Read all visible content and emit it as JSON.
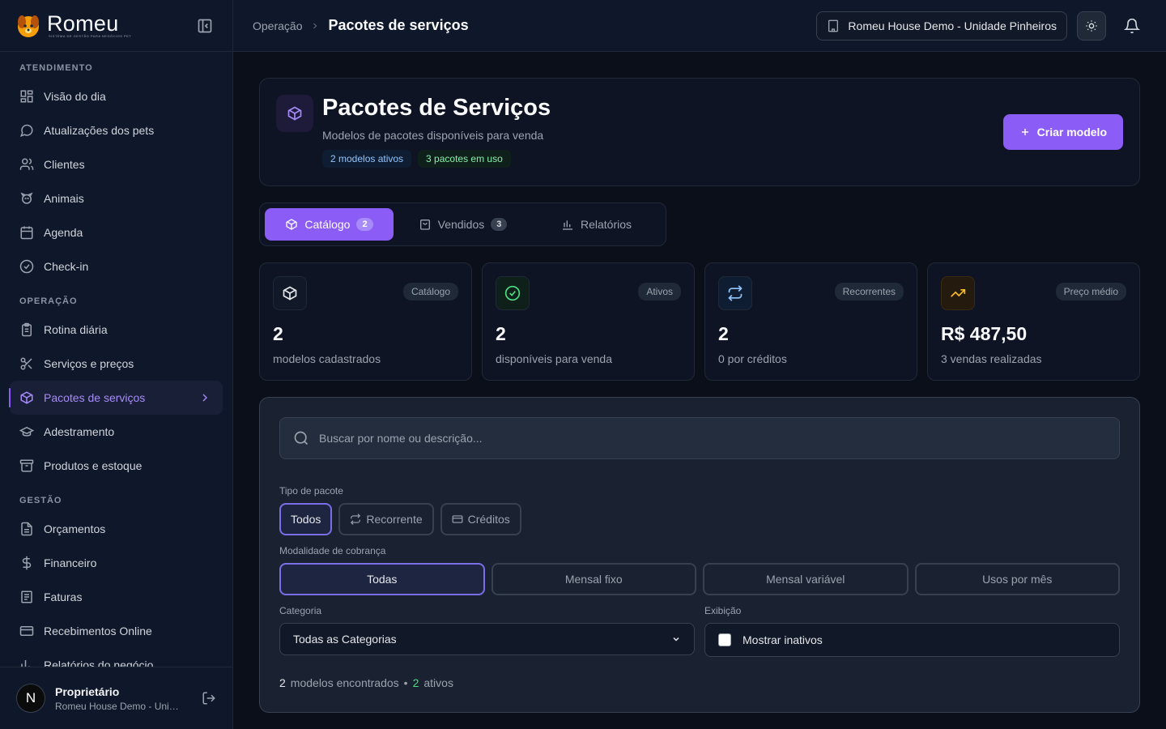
{
  "brand": {
    "name": "Romeu",
    "tagline": "SISTEMA DE GESTÃO PARA NEGÓCIOS PET"
  },
  "sidebar": {
    "sections": [
      {
        "title": "ATENDIMENTO",
        "items": [
          "Visão do dia",
          "Atualizações dos pets",
          "Clientes",
          "Animais",
          "Agenda",
          "Check-in"
        ]
      },
      {
        "title": "OPERAÇÃO",
        "items": [
          "Rotina diária",
          "Serviços e preços",
          "Pacotes de serviços",
          "Adestramento",
          "Produtos e estoque"
        ]
      },
      {
        "title": "GESTÃO",
        "items": [
          "Orçamentos",
          "Financeiro",
          "Faturas",
          "Recebimentos Online",
          "Relatórios do negócio"
        ]
      }
    ],
    "active_item": "Pacotes de serviços"
  },
  "user": {
    "initial": "N",
    "name": "Proprietário",
    "org": "Romeu House Demo - Unidade Pinheiros"
  },
  "topbar": {
    "breadcrumb_parent": "Operação",
    "breadcrumb_current": "Pacotes de serviços",
    "org_selector": "Romeu House Demo - Unidade Pinheiros"
  },
  "hero": {
    "title": "Pacotes de Serviços",
    "subtitle": "Modelos de pacotes disponíveis para venda",
    "badge_active": "2 modelos ativos",
    "badge_in_use": "3 pacotes em uso",
    "create_button": "Criar modelo"
  },
  "tabs": [
    {
      "label": "Catálogo",
      "count": "2"
    },
    {
      "label": "Vendidos",
      "count": "3"
    },
    {
      "label": "Relatórios",
      "count": ""
    }
  ],
  "stats": [
    {
      "label": "Catálogo",
      "value": "2",
      "desc": "modelos cadastrados",
      "icon": "box-icon",
      "color": "#e5e7eb"
    },
    {
      "label": "Ativos",
      "value": "2",
      "desc": "disponíveis para venda",
      "icon": "check-circle-icon",
      "color": "#4ade80"
    },
    {
      "label": "Recorrentes",
      "value": "2",
      "desc": "0 por créditos",
      "icon": "repeat-icon",
      "color": "#93c5fd"
    },
    {
      "label": "Preço médio",
      "value": "R$ 487,50",
      "desc": "3 vendas realizadas",
      "icon": "trending-up-icon",
      "color": "#fbbf24"
    }
  ],
  "filters": {
    "search_placeholder": "Buscar por nome ou descrição...",
    "type_label": "Tipo de pacote",
    "types": [
      "Todos",
      "Recorrente",
      "Créditos"
    ],
    "mode_label": "Modalidade de cobrança",
    "modes": [
      "Todas",
      "Mensal fixo",
      "Mensal variável",
      "Usos por mês"
    ],
    "category_label": "Categoria",
    "category_value": "Todas as Categorias",
    "display_label": "Exibição",
    "show_inactive": "Mostrar inativos"
  },
  "summary": {
    "found_count": "2",
    "found_label": "modelos encontrados",
    "dot": "•",
    "active_count": "2",
    "active_label": "ativos"
  }
}
